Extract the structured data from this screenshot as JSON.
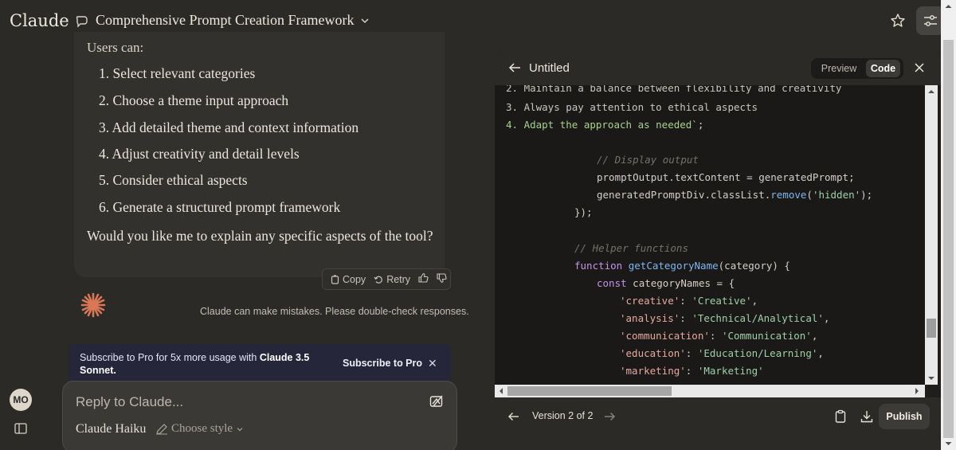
{
  "topbar": {
    "brand": "Claude",
    "chat_title": "Comprehensive Prompt Creation Framework"
  },
  "message": {
    "intro": "Users can:",
    "items": [
      "1. Select relevant categories",
      "2. Choose a theme input approach",
      "3. Add detailed theme and context information",
      "4. Adjust creativity and detail levels",
      "5. Consider ethical aspects",
      "6. Generate a structured prompt framework"
    ],
    "closing": "Would you like me to explain any specific aspects of the tool?"
  },
  "message_actions": {
    "copy": "Copy",
    "retry": "Retry"
  },
  "disclaimer": "Claude can make mistakes. Please double-check responses.",
  "subscribe_banner": {
    "text_prefix": "Subscribe to Pro for 5x more usage with ",
    "text_bold": "Claude 3.5 Sonnet.",
    "button": "Subscribe to Pro"
  },
  "composer": {
    "placeholder": "Reply to Claude...",
    "model": "Claude Haiku",
    "style": "Choose style"
  },
  "user": {
    "initials": "MO"
  },
  "artifact": {
    "title": "Untitled",
    "tabs": {
      "preview": "Preview",
      "code": "Code"
    },
    "version": "Version 2 of 2",
    "publish": "Publish",
    "code": {
      "l1": "2. Maintain a balance between flexibility and creativity",
      "l2": "3. Always pay attention to ethical aspects",
      "l3": "4. Adapt the approach as needed`",
      "l3b": ";",
      "l4": "// Display output",
      "l5a": "promptOutput.textContent = generatedPrompt;",
      "l6a": "generatedPromptDiv.classList.",
      "l6b": "remove",
      "l6c": "(",
      "l6d": "'hidden'",
      "l6e": ");",
      "l7": "});",
      "l8": "// Helper functions",
      "l9a": "function",
      "l9b": "getCategoryName",
      "l9c": "(category) {",
      "l10a": "const",
      "l10b": "categoryNames = {",
      "entries": [
        {
          "key": "'creative'",
          "val": "'Creative'"
        },
        {
          "key": "'analysis'",
          "val": "'Technical/Analytical'"
        },
        {
          "key": "'communication'",
          "val": "'Communication'"
        },
        {
          "key": "'education'",
          "val": "'Education/Learning'"
        },
        {
          "key": "'marketing'",
          "val": "'Marketing'"
        }
      ]
    }
  }
}
